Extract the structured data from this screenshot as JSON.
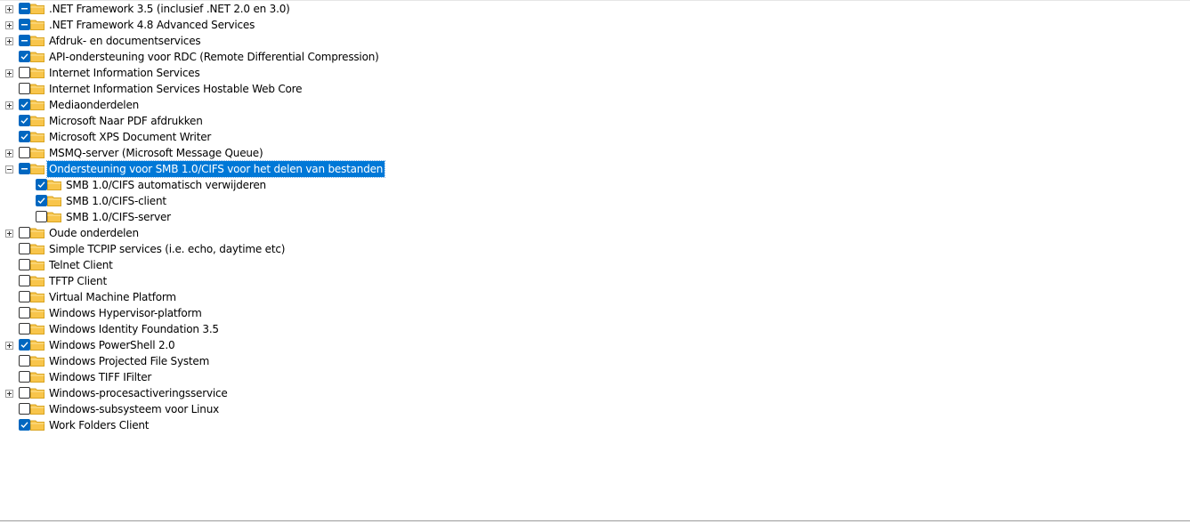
{
  "colors": {
    "accent": "#0067c0",
    "selection": "#0078d7",
    "folder": "#f8c54b"
  },
  "features": [
    {
      "label": ".NET Framework 3.5 (inclusief .NET 2.0 en 3.0)",
      "state": "partial",
      "expand": "collapsed",
      "level": 0
    },
    {
      "label": ".NET Framework 4.8 Advanced Services",
      "state": "partial",
      "expand": "collapsed",
      "level": 0
    },
    {
      "label": "Afdruk- en documentservices",
      "state": "partial",
      "expand": "collapsed",
      "level": 0
    },
    {
      "label": "API-ondersteuning voor RDC (Remote Differential Compression)",
      "state": "checked",
      "expand": "none",
      "level": 0
    },
    {
      "label": "Internet Information Services",
      "state": "unchecked",
      "expand": "collapsed",
      "level": 0
    },
    {
      "label": "Internet Information Services Hostable Web Core",
      "state": "unchecked",
      "expand": "none",
      "level": 0
    },
    {
      "label": "Mediaonderdelen",
      "state": "checked",
      "expand": "collapsed",
      "level": 0
    },
    {
      "label": "Microsoft Naar PDF afdrukken",
      "state": "checked",
      "expand": "none",
      "level": 0
    },
    {
      "label": "Microsoft XPS Document Writer",
      "state": "checked",
      "expand": "none",
      "level": 0
    },
    {
      "label": "MSMQ-server (Microsoft Message Queue)",
      "state": "unchecked",
      "expand": "collapsed",
      "level": 0
    },
    {
      "label": "Ondersteuning voor SMB 1.0/CIFS voor het delen van bestanden",
      "state": "partial",
      "expand": "expanded",
      "level": 0,
      "selected": true
    },
    {
      "label": "SMB 1.0/CIFS automatisch verwijderen",
      "state": "checked",
      "expand": "none",
      "level": 1
    },
    {
      "label": "SMB 1.0/CIFS-client",
      "state": "checked",
      "expand": "none",
      "level": 1
    },
    {
      "label": "SMB 1.0/CIFS-server",
      "state": "unchecked",
      "expand": "none",
      "level": 1
    },
    {
      "label": "Oude onderdelen",
      "state": "unchecked",
      "expand": "collapsed",
      "level": 0
    },
    {
      "label": "Simple TCPIP services (i.e. echo, daytime etc)",
      "state": "unchecked",
      "expand": "none",
      "level": 0
    },
    {
      "label": "Telnet Client",
      "state": "unchecked",
      "expand": "none",
      "level": 0
    },
    {
      "label": "TFTP Client",
      "state": "unchecked",
      "expand": "none",
      "level": 0
    },
    {
      "label": "Virtual Machine Platform",
      "state": "unchecked",
      "expand": "none",
      "level": 0
    },
    {
      "label": "Windows Hypervisor-platform",
      "state": "unchecked",
      "expand": "none",
      "level": 0
    },
    {
      "label": "Windows Identity Foundation 3.5",
      "state": "unchecked",
      "expand": "none",
      "level": 0
    },
    {
      "label": "Windows PowerShell 2.0",
      "state": "checked",
      "expand": "collapsed",
      "level": 0
    },
    {
      "label": "Windows Projected File System",
      "state": "unchecked",
      "expand": "none",
      "level": 0
    },
    {
      "label": "Windows TIFF IFilter",
      "state": "unchecked",
      "expand": "none",
      "level": 0
    },
    {
      "label": "Windows-procesactiveringsservice",
      "state": "unchecked",
      "expand": "collapsed",
      "level": 0
    },
    {
      "label": "Windows-subsysteem voor Linux",
      "state": "unchecked",
      "expand": "none",
      "level": 0
    },
    {
      "label": "Work Folders Client",
      "state": "checked",
      "expand": "none",
      "level": 0
    }
  ]
}
